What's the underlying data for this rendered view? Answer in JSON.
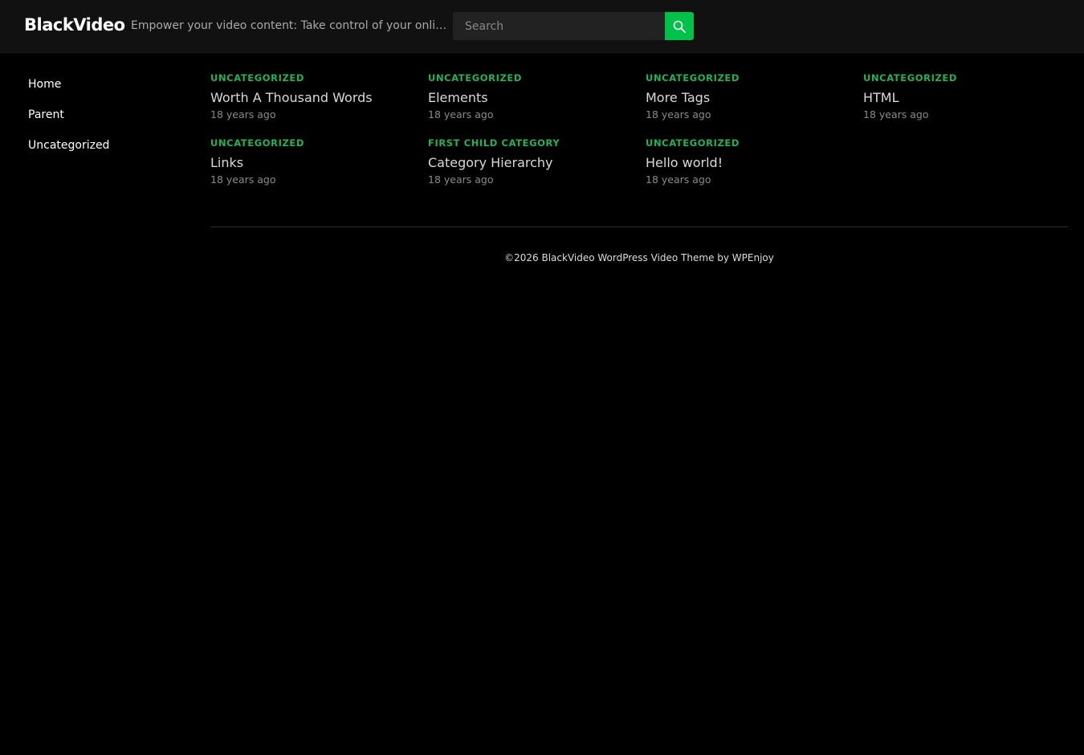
{
  "header": {
    "site_title": "BlackVideo",
    "tagline": "Empower your video content: Take control of your online video presence",
    "search": {
      "placeholder": "Search",
      "value": ""
    },
    "search_button_icon": "search-icon",
    "accent_color": "#00c14a"
  },
  "sidebar": {
    "items": [
      {
        "label": "Home"
      },
      {
        "label": "Parent"
      },
      {
        "label": "Uncategorized"
      }
    ]
  },
  "posts": [
    {
      "category": "Uncategorized",
      "title": "Worth A Thousand Words",
      "date": "18 years ago"
    },
    {
      "category": "Uncategorized",
      "title": "Elements",
      "date": "18 years ago"
    },
    {
      "category": "Uncategorized",
      "title": "More Tags",
      "date": "18 years ago"
    },
    {
      "category": "Uncategorized",
      "title": "HTML",
      "date": "18 years ago"
    },
    {
      "category": "Uncategorized",
      "title": "Links",
      "date": "18 years ago"
    },
    {
      "category": "First Child Category",
      "title": "Category Hierarchy",
      "date": "18 years ago"
    },
    {
      "category": "Uncategorized",
      "title": "Hello world!",
      "date": "18 years ago"
    }
  ],
  "footer": {
    "text": "©2026 BlackVideo WordPress Video Theme by WPEnjoy"
  }
}
